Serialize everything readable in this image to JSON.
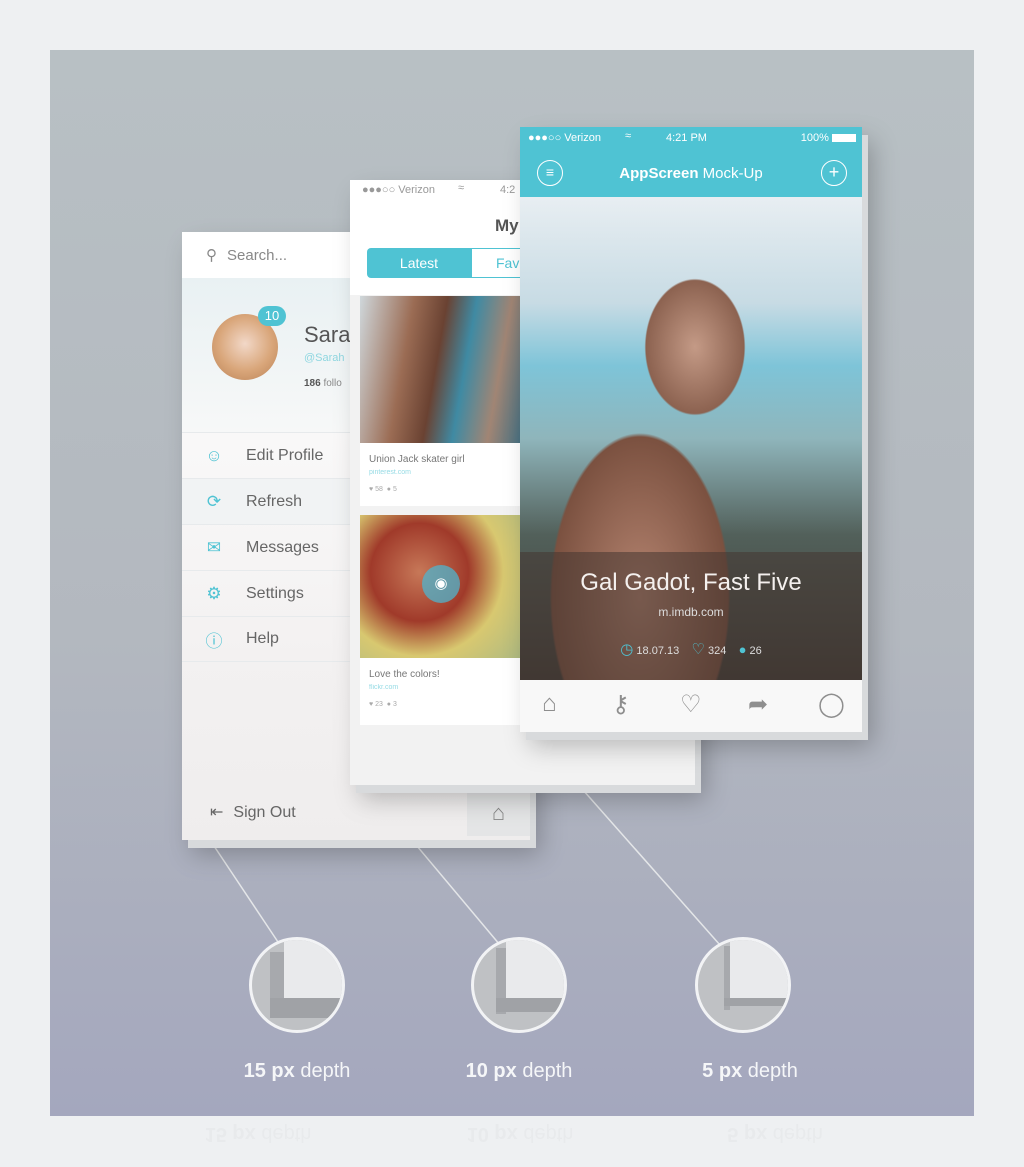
{
  "menu_screen": {
    "search_placeholder": "Search...",
    "badge": "10",
    "name": "Sarah",
    "handle": "@Sarah",
    "followers_count": "186",
    "followers_label": "follo",
    "items": [
      {
        "label": "Edit Profile",
        "icon": "user-icon"
      },
      {
        "label": "Refresh",
        "icon": "refresh-icon"
      },
      {
        "label": "Messages",
        "icon": "mail-icon"
      },
      {
        "label": "Settings",
        "icon": "gear-icon"
      },
      {
        "label": "Help",
        "icon": "help-icon"
      }
    ],
    "sign_out": "Sign Out"
  },
  "feed_screen": {
    "carrier": "●●●○○ Verizon",
    "time": "4:2",
    "title": "My",
    "tabs": [
      "Latest",
      "Fav"
    ],
    "posts": [
      {
        "title": "Union Jack skater girl",
        "source": "pinterest.com",
        "likes": "58",
        "comments": "5"
      },
      {
        "title": "Love the colors!",
        "source": "flickr.com",
        "likes": "23",
        "comments": "3"
      }
    ]
  },
  "main_screen": {
    "carrier": "●●●○○ Verizon",
    "time": "4:21 PM",
    "battery": "100%",
    "title_bold": "AppScreen",
    "title_rest": "Mock-Up",
    "caption": "Gal Gadot, Fast Five",
    "source": "m.imdb.com",
    "date": "18.07.13",
    "likes": "324",
    "comments": "26",
    "accent": "#4fc3d3"
  },
  "depths": [
    {
      "value": "15",
      "unit": "px",
      "label": "depth"
    },
    {
      "value": "10",
      "unit": "px",
      "label": "depth"
    },
    {
      "value": "5",
      "unit": "px",
      "label": "depth"
    }
  ]
}
